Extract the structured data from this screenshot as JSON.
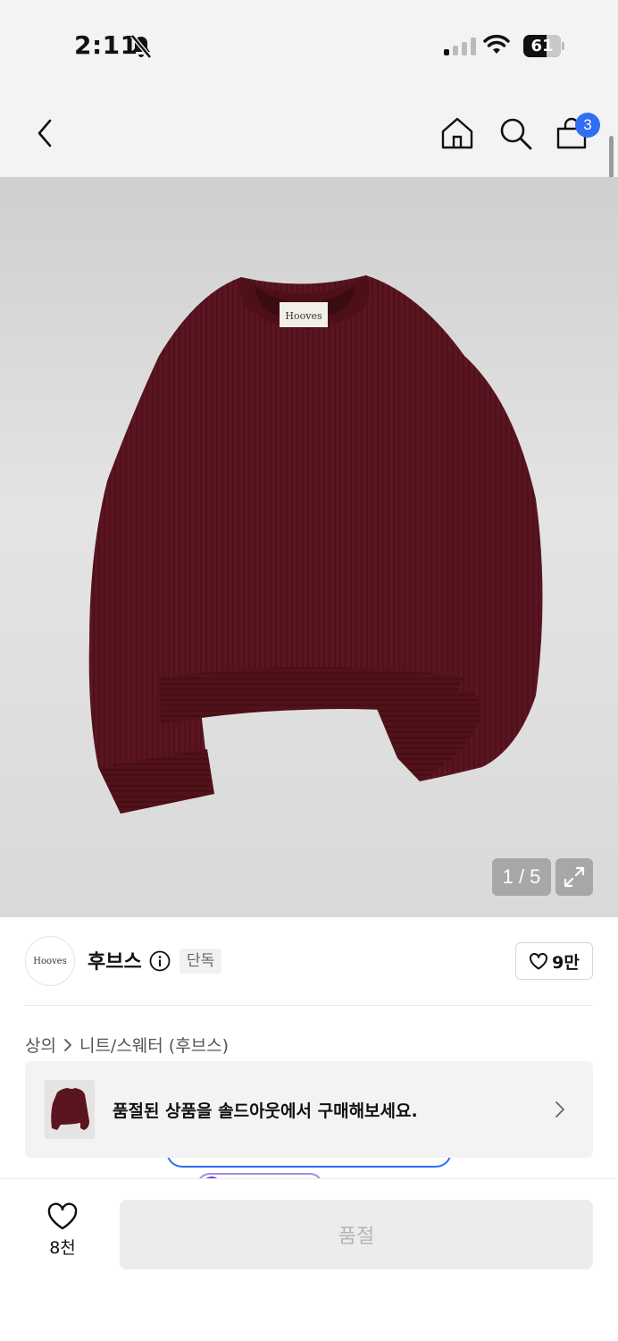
{
  "status_bar": {
    "time": "2:11",
    "battery": "61"
  },
  "nav": {
    "cart_count": "3"
  },
  "gallery": {
    "counter": "1 / 5",
    "label_text": "Hooves"
  },
  "brand": {
    "logo_text": "Hooves",
    "name": "후브스",
    "badge": "단독",
    "likes": "9만"
  },
  "breadcrumb": {
    "category": "상의",
    "subcategory": "니트/스웨터 (후브스)"
  },
  "soldout_banner": {
    "text": "품절된 상품을 솔드아웃에서 구매해보세요."
  },
  "bottom_bar": {
    "wish_count": "8천",
    "buy_label": "품절"
  },
  "colors": {
    "accent": "#2f6ef5",
    "sweater": "#5a1520",
    "disabled_bg": "#ececec",
    "disabled_text": "#b5b5b5"
  }
}
